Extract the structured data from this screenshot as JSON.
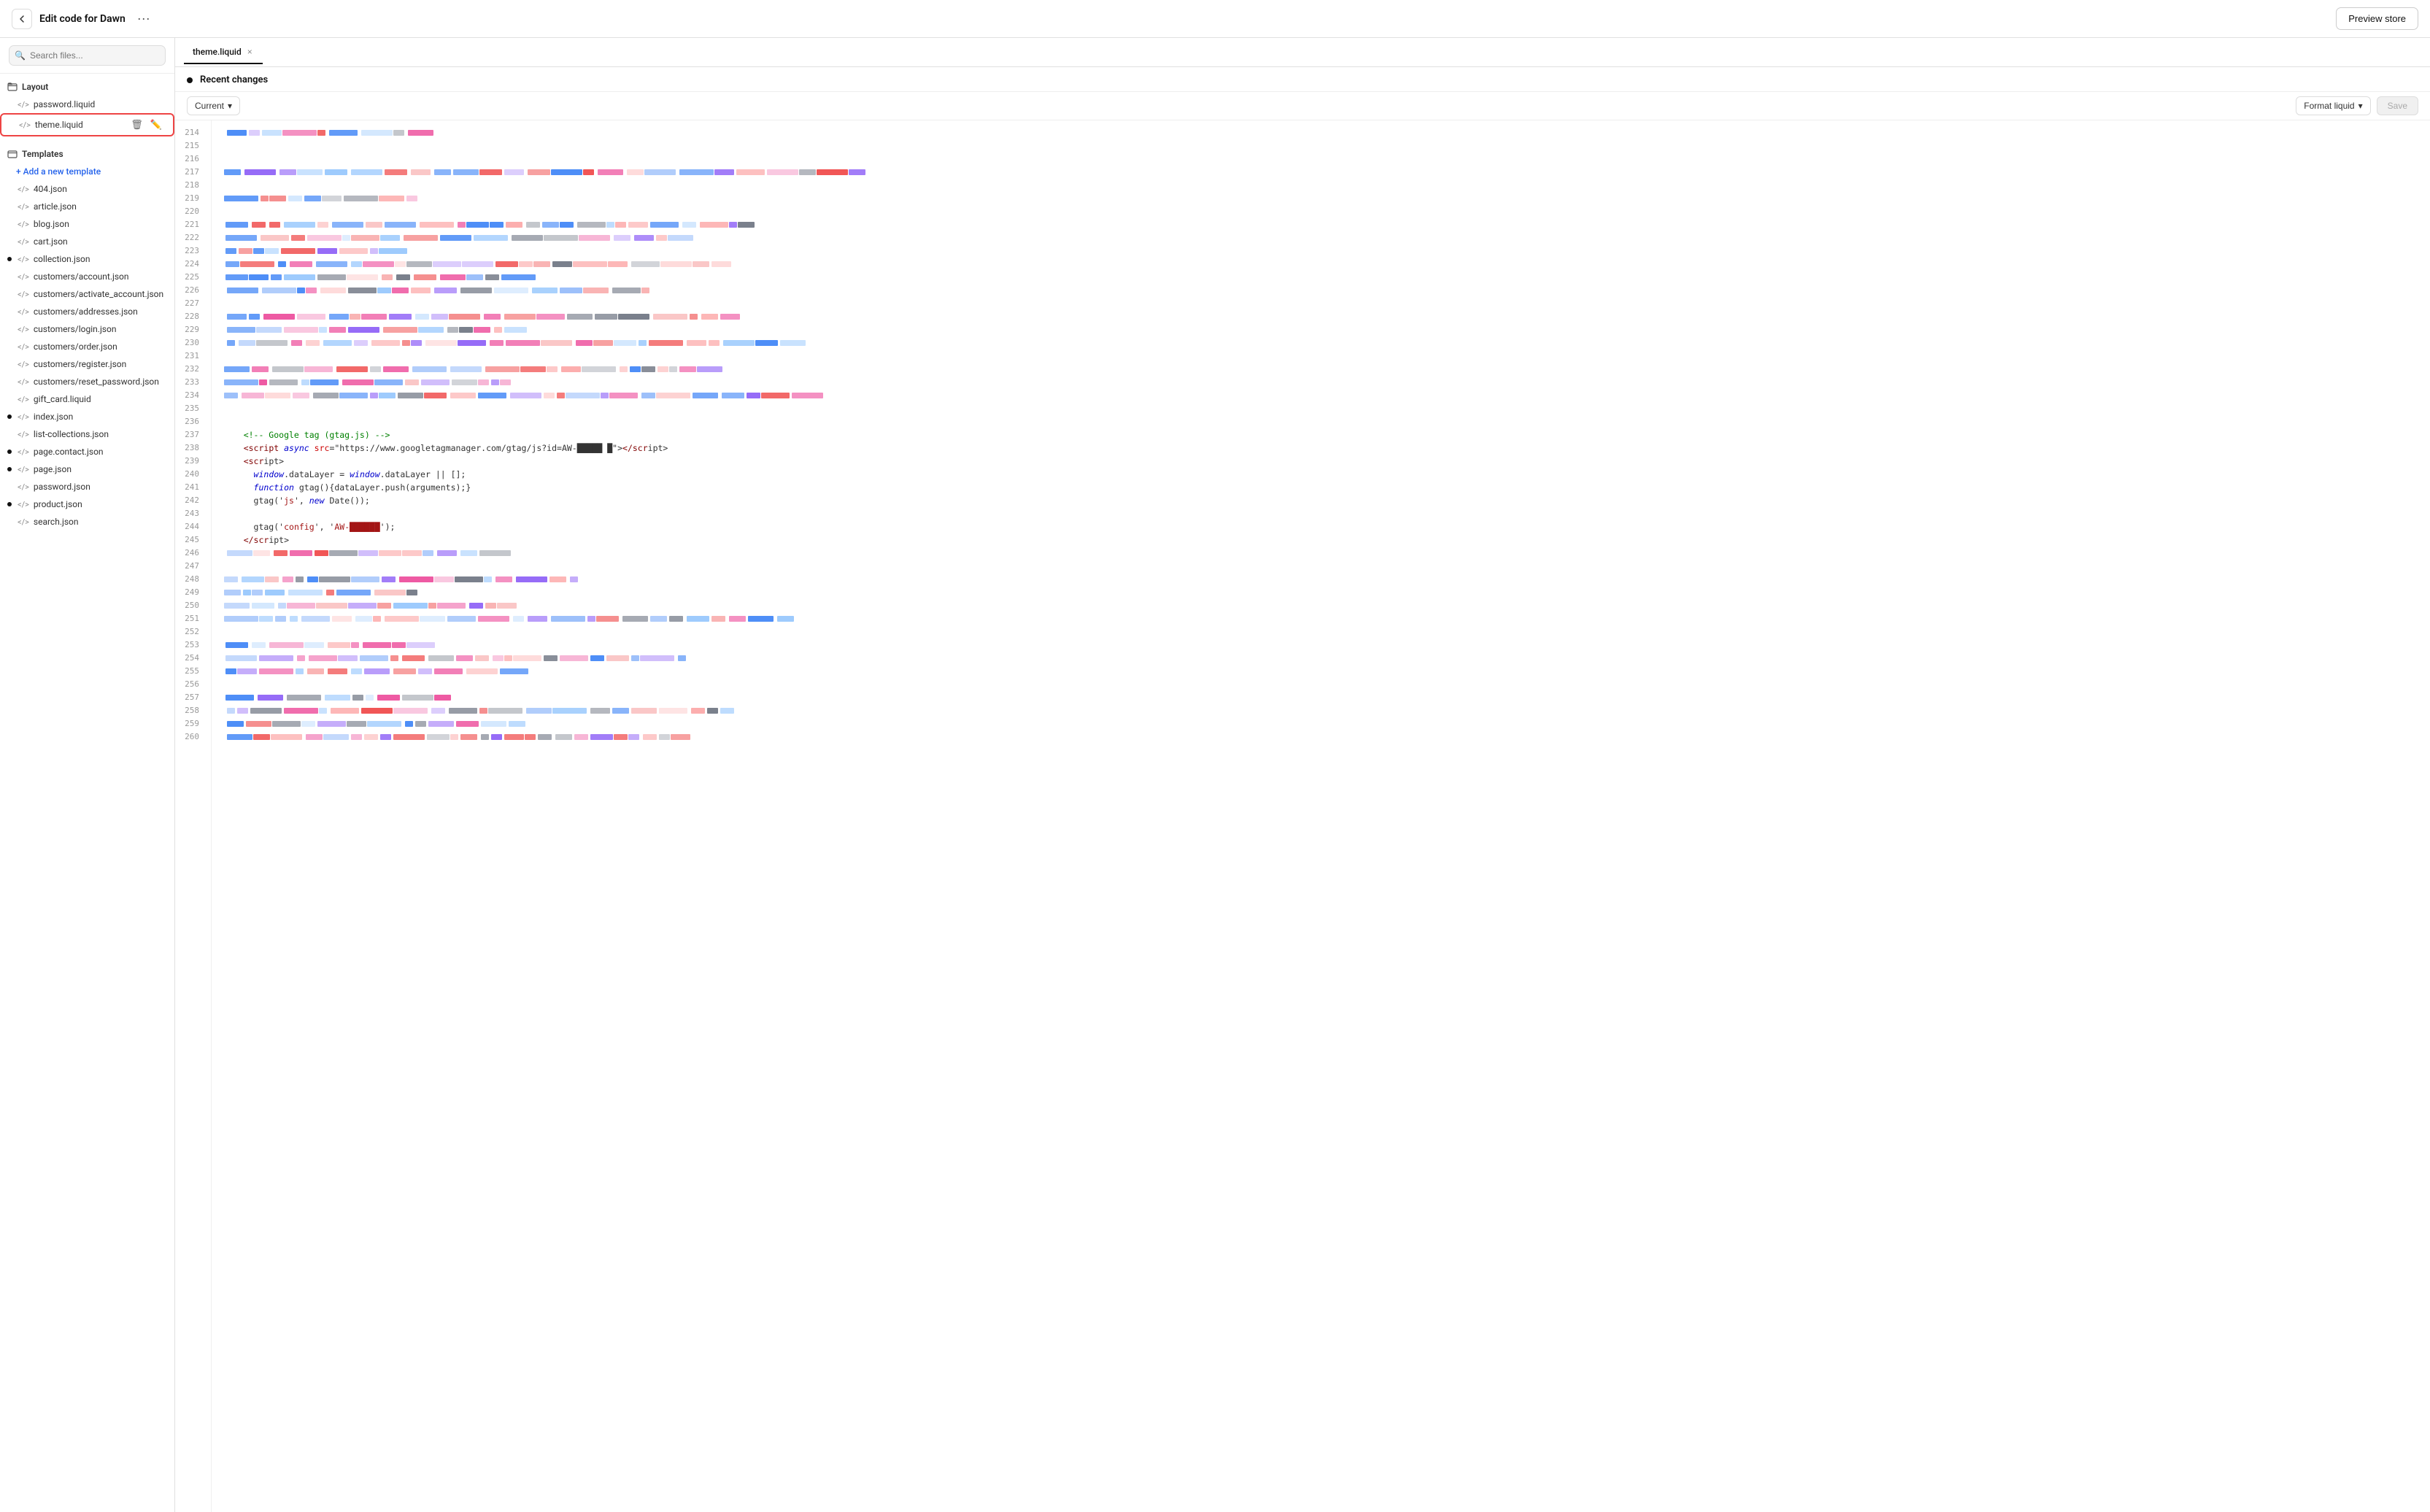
{
  "header": {
    "title": "Edit code for Dawn",
    "more_label": "···",
    "preview_label": "Preview store",
    "back_icon": "←"
  },
  "search": {
    "placeholder": "Search files..."
  },
  "sidebar": {
    "layout_section": {
      "label": "Layout",
      "items": [
        {
          "name": "password.liquid",
          "type": "code",
          "dot": false
        },
        {
          "name": "theme.liquid",
          "type": "code",
          "dot": false,
          "active": true
        }
      ]
    },
    "templates_section": {
      "label": "Templates",
      "add_label": "+ Add a new template",
      "items": [
        {
          "name": "404.json",
          "type": "code",
          "dot": false
        },
        {
          "name": "article.json",
          "type": "code",
          "dot": false
        },
        {
          "name": "blog.json",
          "type": "code",
          "dot": false
        },
        {
          "name": "cart.json",
          "type": "code",
          "dot": false
        },
        {
          "name": "collection.json",
          "type": "code",
          "dot": true
        },
        {
          "name": "customers/account.json",
          "type": "code",
          "dot": false
        },
        {
          "name": "customers/activate_account.json",
          "type": "code",
          "dot": false
        },
        {
          "name": "customers/addresses.json",
          "type": "code",
          "dot": false
        },
        {
          "name": "customers/login.json",
          "type": "code",
          "dot": false
        },
        {
          "name": "customers/order.json",
          "type": "code",
          "dot": false
        },
        {
          "name": "customers/register.json",
          "type": "code",
          "dot": false
        },
        {
          "name": "customers/reset_password.json",
          "type": "code",
          "dot": false
        },
        {
          "name": "gift_card.liquid",
          "type": "code",
          "dot": false
        },
        {
          "name": "index.json",
          "type": "code",
          "dot": true
        },
        {
          "name": "list-collections.json",
          "type": "code",
          "dot": false
        },
        {
          "name": "page.contact.json",
          "type": "code",
          "dot": true
        },
        {
          "name": "page.json",
          "type": "code",
          "dot": true
        },
        {
          "name": "password.json",
          "type": "code",
          "dot": false
        },
        {
          "name": "product.json",
          "type": "code",
          "dot": true
        },
        {
          "name": "search.json",
          "type": "code",
          "dot": false
        }
      ]
    }
  },
  "editor": {
    "tab_name": "theme.liquid",
    "recent_changes_label": "Recent changes",
    "current_label": "Current",
    "format_label": "Format liquid",
    "save_label": "Save",
    "lines": [
      {
        "num": 214,
        "type": "blurred"
      },
      {
        "num": 215,
        "type": "empty"
      },
      {
        "num": 216,
        "type": "empty"
      },
      {
        "num": 217,
        "type": "blurred"
      },
      {
        "num": 218,
        "type": "empty"
      },
      {
        "num": 219,
        "type": "blurred"
      },
      {
        "num": 220,
        "type": "empty"
      },
      {
        "num": 221,
        "type": "blurred"
      },
      {
        "num": 222,
        "type": "blurred"
      },
      {
        "num": 223,
        "type": "blurred"
      },
      {
        "num": 224,
        "type": "blurred"
      },
      {
        "num": 225,
        "type": "blurred"
      },
      {
        "num": 226,
        "type": "blurred"
      },
      {
        "num": 227,
        "type": "empty"
      },
      {
        "num": 228,
        "type": "blurred"
      },
      {
        "num": 229,
        "type": "blurred"
      },
      {
        "num": 230,
        "type": "blurred"
      },
      {
        "num": 231,
        "type": "empty"
      },
      {
        "num": 232,
        "type": "blurred"
      },
      {
        "num": 233,
        "type": "blurred"
      },
      {
        "num": 234,
        "type": "blurred"
      },
      {
        "num": 235,
        "type": "empty"
      },
      {
        "num": 236,
        "type": "empty"
      },
      {
        "num": 237,
        "type": "comment",
        "text": "    <!-- Google tag (gtag.js) -->"
      },
      {
        "num": 238,
        "type": "code",
        "text": "    <script async src=\"https://www.googletagmanager.com/gtag/js?id=AW-█████ █\"></scr​ipt>"
      },
      {
        "num": 239,
        "type": "code",
        "text": "    <scr​ipt>"
      },
      {
        "num": 240,
        "type": "code",
        "text": "      window.dataLayer = window.dataLayer || [];"
      },
      {
        "num": 241,
        "type": "code",
        "text": "      function gtag(){dataLayer.push(arguments);}"
      },
      {
        "num": 242,
        "type": "code",
        "text": "      gtag('js', new Date());"
      },
      {
        "num": 243,
        "type": "empty"
      },
      {
        "num": 244,
        "text": "      gtag('config', 'AW-██████');",
        "type": "code"
      },
      {
        "num": 245,
        "type": "code",
        "text": "    </scr​ipt>"
      },
      {
        "num": 246,
        "type": "blurred_small"
      },
      {
        "num": 247,
        "type": "empty"
      },
      {
        "num": 248,
        "type": "blurred"
      },
      {
        "num": 249,
        "type": "blurred"
      },
      {
        "num": 250,
        "type": "blurred"
      },
      {
        "num": 251,
        "type": "blurred"
      },
      {
        "num": 252,
        "type": "empty"
      },
      {
        "num": 253,
        "type": "blurred"
      },
      {
        "num": 254,
        "type": "blurred"
      },
      {
        "num": 255,
        "type": "blurred"
      },
      {
        "num": 256,
        "type": "empty"
      },
      {
        "num": 257,
        "type": "blurred"
      },
      {
        "num": 258,
        "type": "blurred"
      },
      {
        "num": 259,
        "type": "blurred"
      },
      {
        "num": 260,
        "type": "blurred"
      }
    ]
  }
}
